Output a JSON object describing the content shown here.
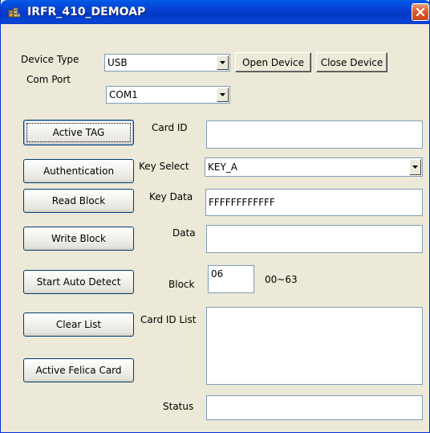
{
  "window": {
    "title": "IRFR_410_DEMOAP"
  },
  "colors": {
    "titlebar": "#0a3ecf",
    "close_button": "#dc5a2f",
    "dialog_face": "#ece9d8",
    "field_border": "#7f9db9"
  },
  "device": {
    "device_type_label": "Device Type",
    "device_type_value": "USB",
    "com_port_label": "Com Port",
    "com_port_value": "COM1",
    "open_label": "Open Device",
    "close_label": "Close Device"
  },
  "buttons": {
    "active_tag": "Active TAG",
    "authentication": "Authentication",
    "read_block": "Read Block",
    "write_block": "Write Block",
    "start_auto_detect": "Start Auto Detect",
    "clear_list": "Clear List",
    "active_felica": "Active Felica Card"
  },
  "fields": {
    "card_id_label": "Card ID",
    "card_id_value": "",
    "key_select_label": "Key Select",
    "key_select_value": "KEY_A",
    "key_data_label": "Key Data",
    "key_data_value": "FFFFFFFFFFFF",
    "data_label": "Data",
    "data_value": "",
    "block_label": "Block",
    "block_value": "06",
    "block_range": "00~63",
    "card_id_list_label": "Card ID List",
    "status_label": "Status",
    "status_value": ""
  },
  "icons": {
    "app_icon": "app-icon",
    "close_icon": "close-icon",
    "dropdown_arrow": "chevron-down-icon"
  }
}
